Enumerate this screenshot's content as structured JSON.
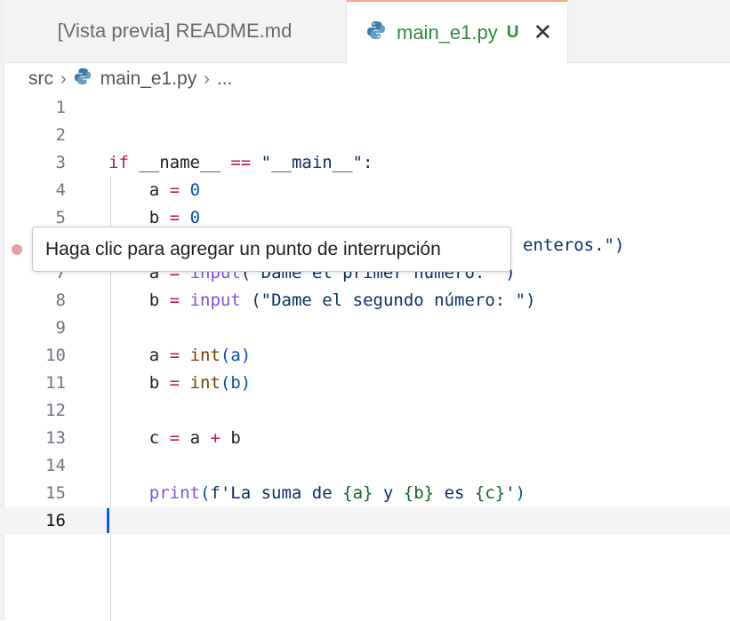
{
  "tabs": [
    {
      "label": "[Vista previa] README.md",
      "active": false
    },
    {
      "label": "main_e1.py",
      "active": true,
      "status": "U",
      "close": "✕"
    }
  ],
  "breadcrumb": {
    "folder": "src",
    "file": "main_e1.py",
    "more": "..."
  },
  "tooltip": {
    "text": "Haga clic para agregar un punto de interrupción"
  },
  "line_numbers": [
    "1",
    "2",
    "3",
    "4",
    "5",
    "6",
    "7",
    "8",
    "9",
    "10",
    "11",
    "12",
    "13",
    "14",
    "15",
    "16"
  ],
  "code": {
    "l3": {
      "kw": "if",
      "name": "__name__",
      "op": "==",
      "str": "\"__main__\"",
      "colon": ":"
    },
    "l4": {
      "var": "a",
      "op": "=",
      "val": "0"
    },
    "l5": {
      "var": "b",
      "op": "=",
      "val": "0"
    },
    "l6_visible": "enteros.\")",
    "l7": {
      "var": "a",
      "op": "=",
      "fn": "input",
      "str": "(\"Dame el primer número: \")"
    },
    "l8": {
      "var": "b",
      "op": "=",
      "fn": "input",
      "str": "(\"Dame el segundo número: \")"
    },
    "l10": {
      "var": "a",
      "op": "=",
      "fn": "int",
      "arg": "(a)"
    },
    "l11": {
      "var": "b",
      "op": "=",
      "fn": "int",
      "arg": "(b)"
    },
    "l13": {
      "var": "c",
      "op": "=",
      "a": "a",
      "plus": "+",
      "b": "b"
    },
    "l15": {
      "fn": "print",
      "open": "(",
      "fstr_start": "f'La suma de ",
      "pa": "{a}",
      "t1": " y ",
      "pb": "{b}",
      "t2": " es ",
      "pc": "{c}",
      "fstr_end": "'",
      "close": ")"
    }
  },
  "colors": {
    "keyword": "#c4183c",
    "string": "#0a3069",
    "number": "#0550ae",
    "modified": "#2d8a3e",
    "tab_accent": "#f5a88b",
    "cursor": "#0b5fd8"
  }
}
